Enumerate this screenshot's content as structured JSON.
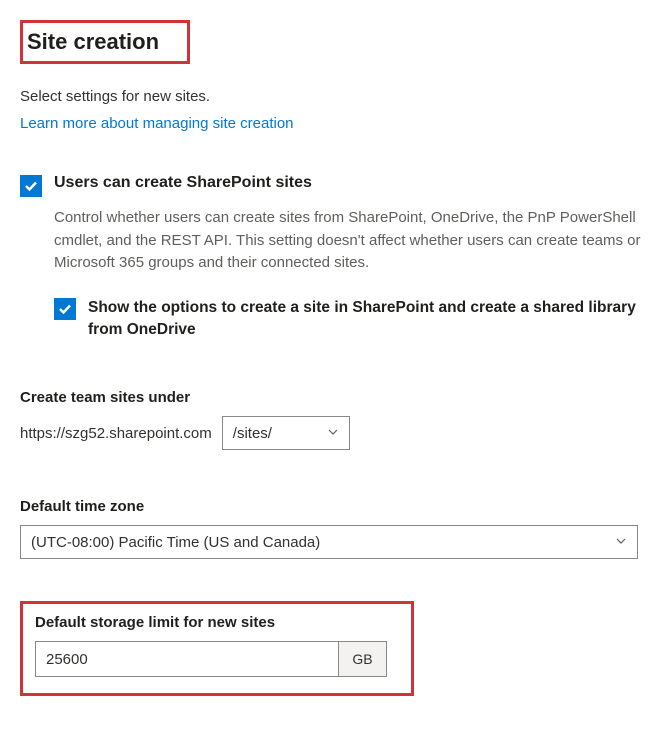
{
  "header": {
    "title": "Site creation"
  },
  "subtitle": "Select settings for new sites.",
  "learnMoreLink": "Learn more about managing site creation",
  "option1": {
    "label": "Users can create SharePoint sites",
    "desc": "Control whether users can create sites from SharePoint, OneDrive, the PnP PowerShell cmdlet, and the REST API. This setting doesn't affect whether users can create teams or Microsoft 365 groups and their connected sites."
  },
  "option1a": {
    "label": "Show the options to create a site in SharePoint and create a shared library from OneDrive"
  },
  "teamSitesUnder": {
    "label": "Create team sites under",
    "urlPrefix": "https://szg52.sharepoint.com",
    "path": "/sites/"
  },
  "timezone": {
    "label": "Default time zone",
    "value": "(UTC-08:00) Pacific Time (US and Canada)"
  },
  "storage": {
    "label": "Default storage limit for new sites",
    "value": "25600",
    "unit": "GB"
  }
}
